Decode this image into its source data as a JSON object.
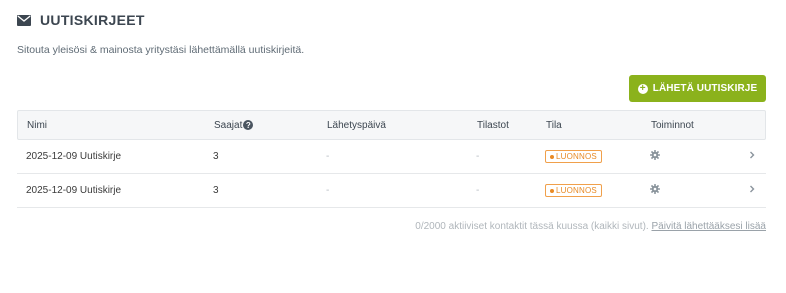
{
  "header": {
    "title": "UUTISKIRJEET",
    "icon": "envelope-icon"
  },
  "subtitle": "Sitouta yleisösi & mainosta yritystäsi lähettämällä uutiskirjeitä.",
  "send_button": {
    "label": "LÄHETÄ UUTISKIRJE",
    "icon": "plus-circle-icon",
    "color": "#8bb21c"
  },
  "table": {
    "columns": {
      "name": "Nimi",
      "recipients": "Saajat",
      "send_date": "Lähetyspäivä",
      "stats": "Tilastot",
      "status": "Tila",
      "actions": "Toiminnot"
    },
    "rows": [
      {
        "name": "2025-12-09 Uutiskirje",
        "recipients": "3",
        "send_date": "-",
        "stats": "-",
        "status": "LUONNOS"
      },
      {
        "name": "2025-12-09 Uutiskirje",
        "recipients": "3",
        "send_date": "-",
        "stats": "-",
        "status": "LUONNOS"
      }
    ]
  },
  "footer": {
    "text": "0/2000 aktiiviset kontaktit tässä kuussa (kaikki sivut).",
    "link": "Päivitä lähettääksesi lisää"
  },
  "colors": {
    "accent": "#8bb21c",
    "status_draft": "#e88a25"
  }
}
